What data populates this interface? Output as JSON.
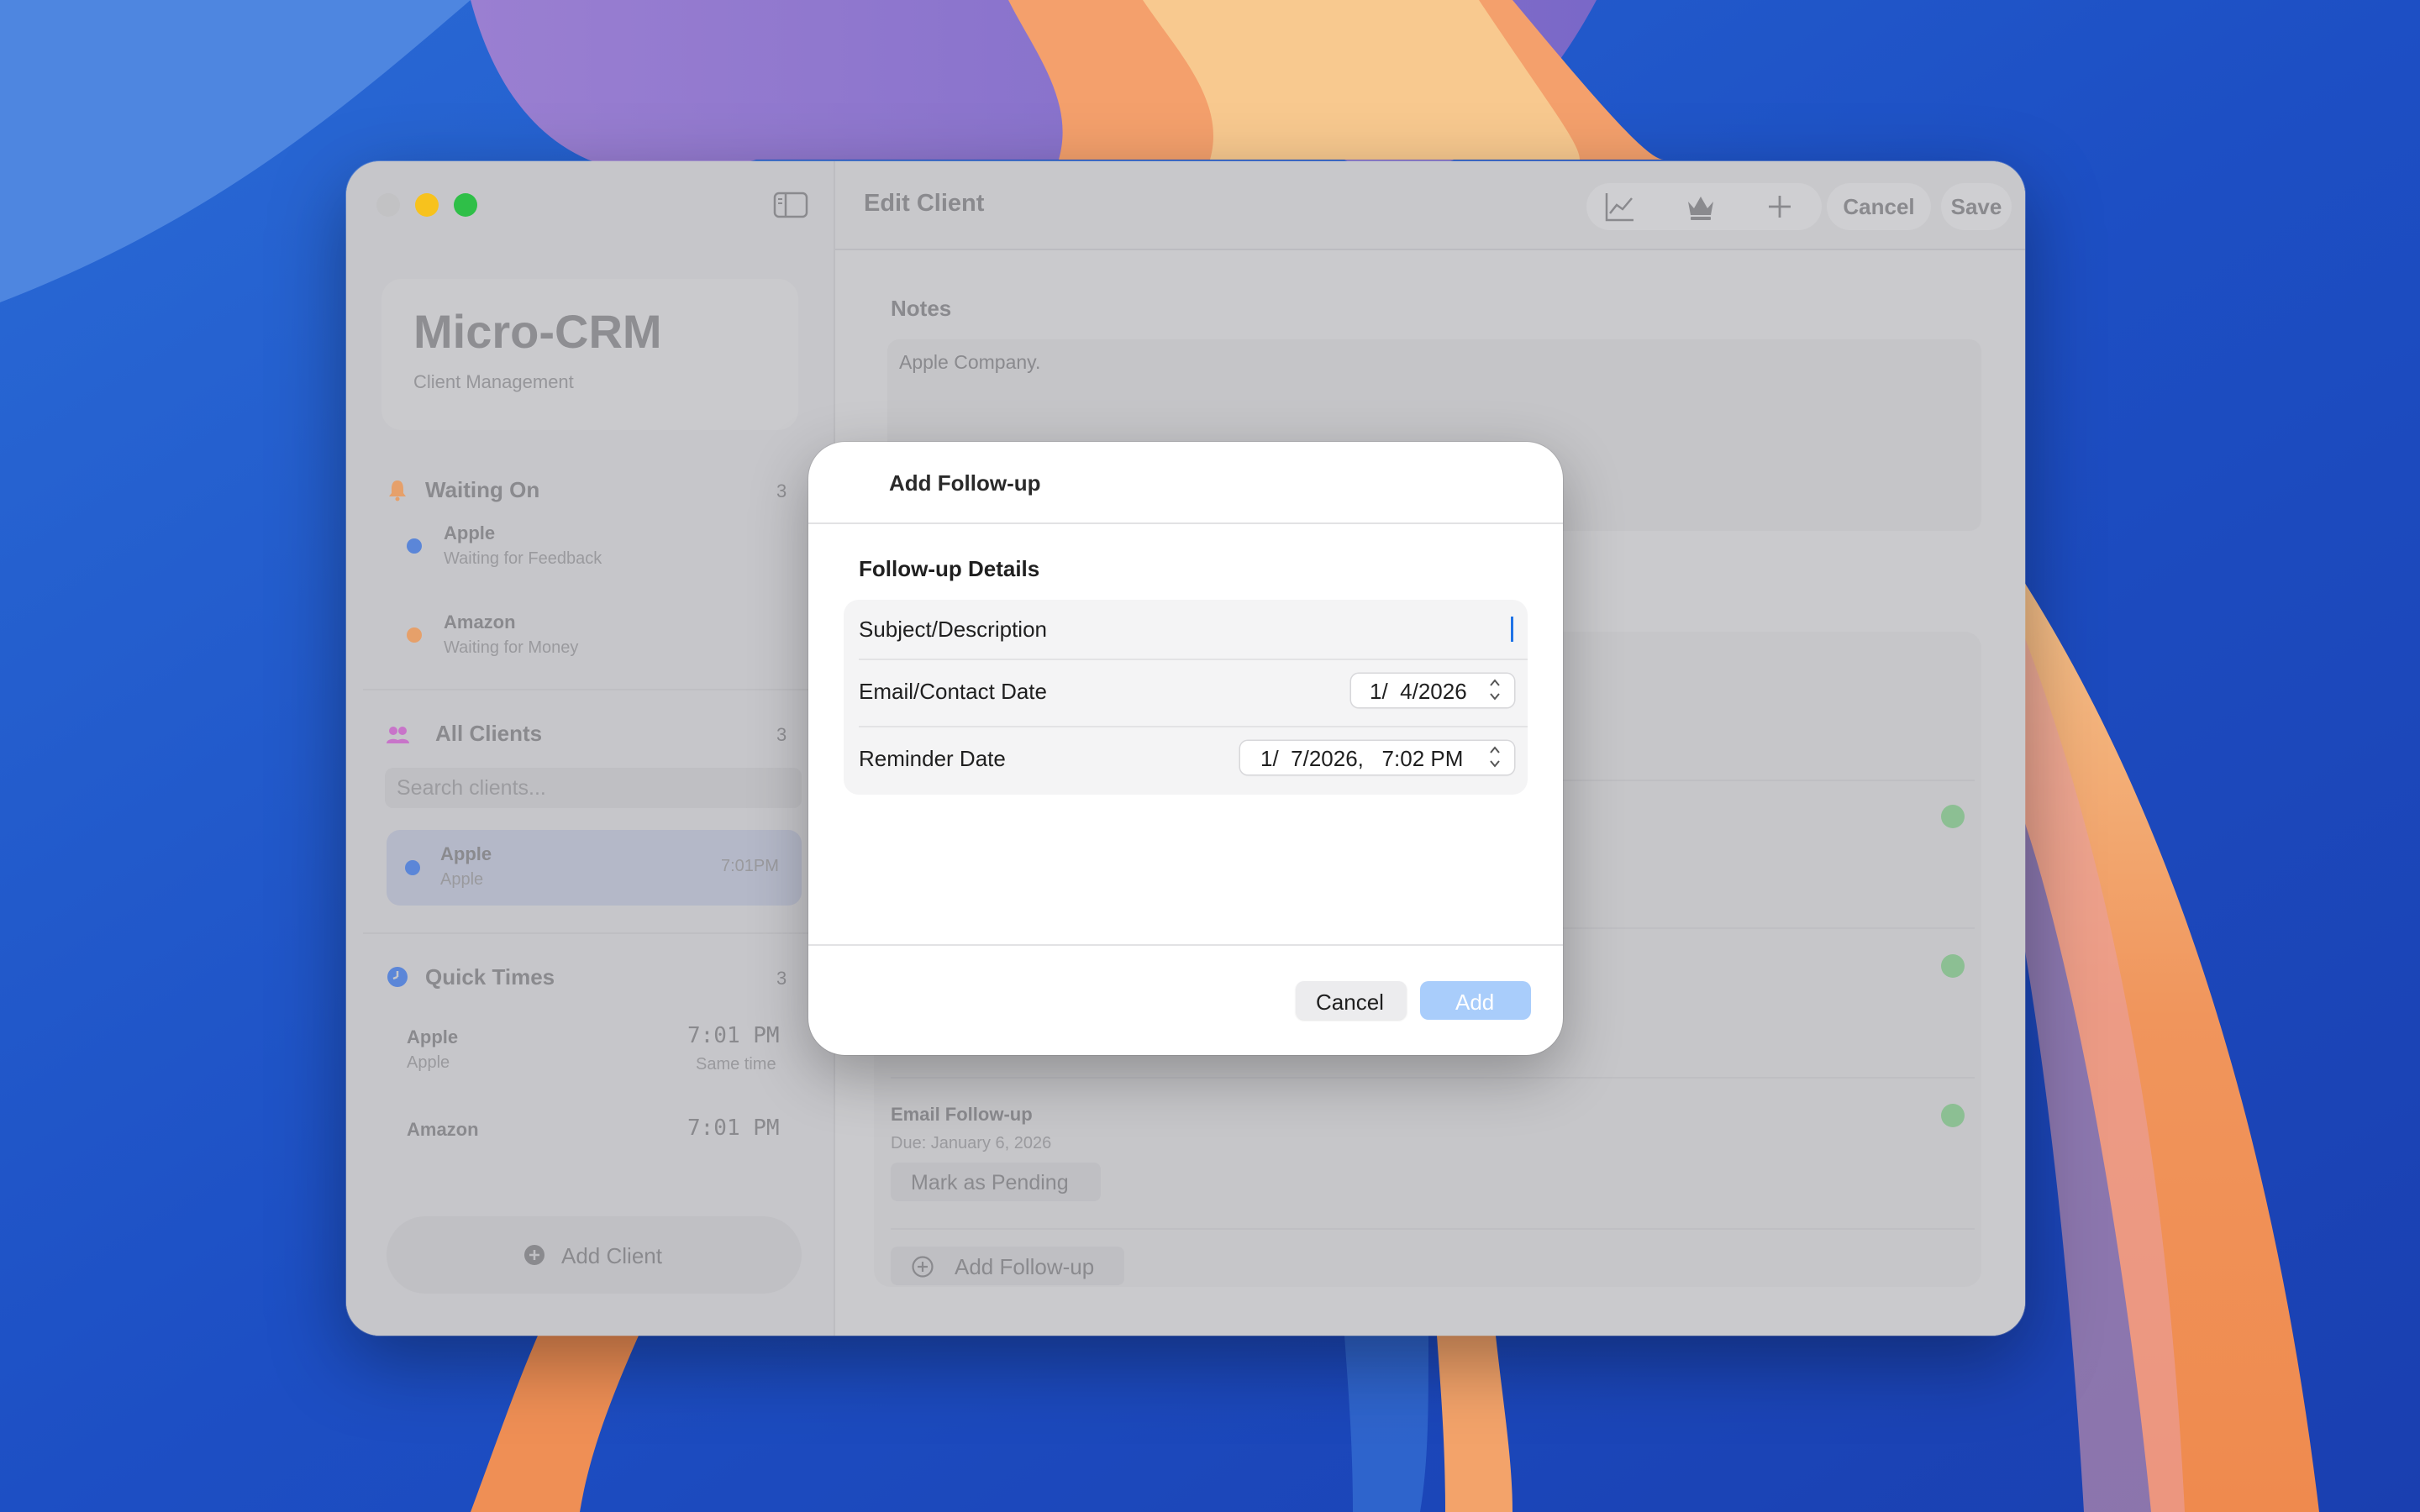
{
  "window": {
    "title": "Edit Client",
    "toolbar": {
      "icons": [
        "chart-icon",
        "crown-icon",
        "plus-icon"
      ],
      "cancel_label": "Cancel",
      "save_label": "Save"
    }
  },
  "sidebar": {
    "brand_title": "Micro-CRM",
    "brand_subtitle": "Client Management",
    "waiting_on": {
      "title": "Waiting On",
      "count": "3",
      "items": [
        {
          "name": "Apple",
          "status": "Waiting for Feedback",
          "color": "#5b86d8"
        },
        {
          "name": "Amazon",
          "status": "Waiting for Money",
          "color": "#e6a06a"
        }
      ]
    },
    "all_clients": {
      "title": "All Clients",
      "count": "3",
      "search_placeholder": "Search clients...",
      "items": [
        {
          "name": "Apple",
          "company": "Apple",
          "time": "7:01PM",
          "color": "#5b86d8"
        }
      ]
    },
    "quick_times": {
      "title": "Quick Times",
      "count": "3",
      "items": [
        {
          "name": "Apple",
          "company": "Apple",
          "time": "7:01 PM",
          "note": "Same time"
        },
        {
          "name": "Amazon",
          "time": "7:01 PM"
        }
      ]
    },
    "add_client_label": "Add Client"
  },
  "content": {
    "notes_label": "Notes",
    "notes_text": "Apple Company.",
    "followup": {
      "title": "Email Follow-up",
      "due": "Due: January 6, 2026",
      "mark_pending_label": "Mark as Pending"
    },
    "add_followup_label": "Add Follow-up"
  },
  "dialog": {
    "title": "Add Follow-up",
    "section_title": "Follow-up Details",
    "subject_label": "Subject/Description",
    "subject_value": "",
    "contact_date_label": "Email/Contact Date",
    "contact_date_value": "1/  4/2026",
    "reminder_date_label": "Reminder Date",
    "reminder_date_value": "1/  7/2026,   7:02 PM",
    "cancel_label": "Cancel",
    "add_label": "Add"
  },
  "colors": {
    "accent": "#1f73e6",
    "add_button_disabled": "#a9cdfb",
    "check_green": "#8cbf93"
  }
}
